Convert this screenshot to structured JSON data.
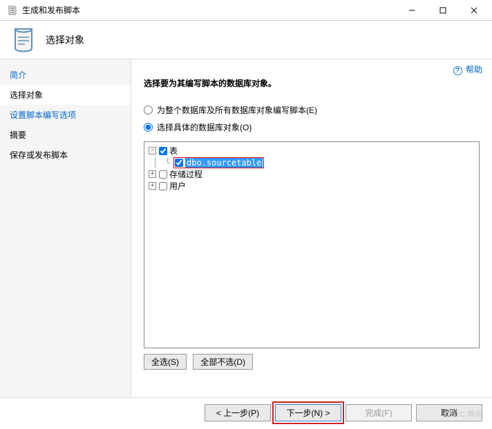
{
  "window": {
    "title": "生成和发布脚本"
  },
  "header": {
    "title": "选择对象"
  },
  "help": {
    "label": "帮助"
  },
  "sidebar": {
    "items": [
      {
        "label": "简介"
      },
      {
        "label": "选择对象"
      },
      {
        "label": "设置脚本编写选项"
      },
      {
        "label": "摘要"
      },
      {
        "label": "保存或发布脚本"
      }
    ]
  },
  "main": {
    "instruction": "选择要为其编写脚本的数据库对象。",
    "radios": {
      "all": "为整个数据库及所有数据库对象编写脚本(E)",
      "specific": "选择具体的数据库对象(O)"
    },
    "tree": {
      "root": "表",
      "child": "dbo.sourcetable",
      "node2": "存储过程",
      "node3": "用户"
    },
    "buttons": {
      "select_all": "全选(S)",
      "deselect_all": "全部不选(D)"
    }
  },
  "footer": {
    "prev": "< 上一步(P)",
    "next": "下一步(N) >",
    "finish": "完成(F)",
    "cancel": "取消"
  },
  "watermark": "@51C 博客"
}
